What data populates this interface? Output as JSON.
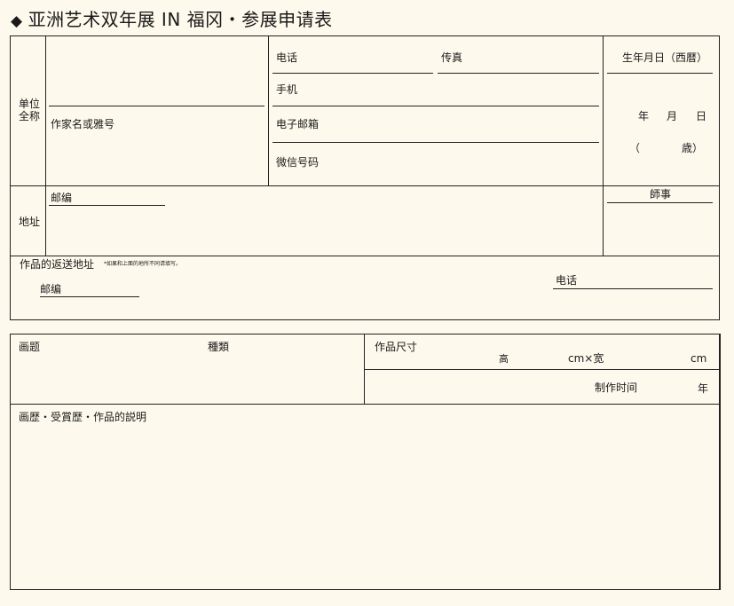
{
  "title": "亚洲艺术双年展 IN 福冈・参展申请表",
  "title_icon": "diamond-icon",
  "section1": {
    "unit_label_line1": "单位",
    "unit_label_line2": "全称",
    "artist_name_label": "作家名或雅号",
    "phone_label": "电话",
    "fax_label": "传真",
    "mobile_label": "手机",
    "email_label": "电子邮箱",
    "wechat_label": "微信号码",
    "birth_label": "生年月日（西暦）",
    "year_label": "年",
    "month_label": "月",
    "day_label": "日",
    "age_open": "（",
    "age_close": "歳）",
    "address_label": "地址",
    "postcode_label": "邮编",
    "teacher_label": "師事",
    "return_address_label": "作品的返送地址",
    "return_note": "*如果和上面的地所不同请填写。",
    "return_postcode_label": "邮编",
    "return_phone_label": "电话"
  },
  "section2": {
    "painting_title_label": "画题",
    "type_label": "種類",
    "size_label": "作品尺寸",
    "height_label": "高",
    "cm_width_label": "cm×宽",
    "cm_label": "cm",
    "production_time_label": "制作时间",
    "production_year_label": "年",
    "history_label": "画歴・受賞歴・作品的説明"
  }
}
